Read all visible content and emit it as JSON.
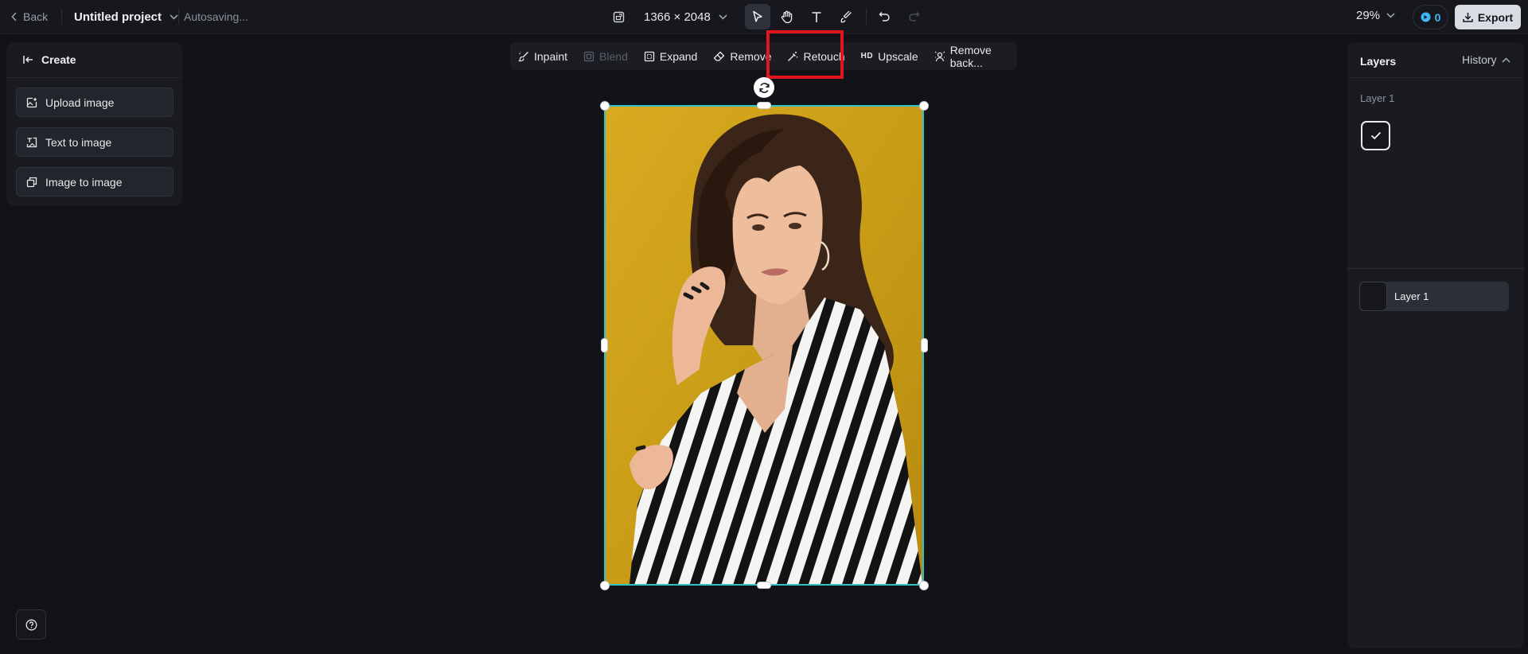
{
  "topbar": {
    "back_label": "Back",
    "project_title": "Untitled project",
    "autosave_status": "Autosaving...",
    "canvas_size": "1366 × 2048",
    "zoom_level": "29%",
    "credits_count": "0",
    "export_label": "Export"
  },
  "tools": [
    "select-icon",
    "hand-icon",
    "text-icon",
    "brush-icon",
    "undo-icon",
    "redo-icon"
  ],
  "create_panel": {
    "title": "Create",
    "buttons": [
      {
        "label": "Upload image",
        "icon": "upload-image-icon"
      },
      {
        "label": "Text to image",
        "icon": "text-to-image-icon"
      },
      {
        "label": "Image to image",
        "icon": "image-to-image-icon"
      }
    ]
  },
  "edit_toolbar": {
    "items": [
      {
        "label": "Inpaint",
        "icon": "inpaint-icon",
        "enabled": true
      },
      {
        "label": "Blend",
        "icon": "blend-icon",
        "enabled": false
      },
      {
        "label": "Expand",
        "icon": "expand-icon",
        "enabled": true
      },
      {
        "label": "Remove",
        "icon": "eraser-icon",
        "enabled": true
      },
      {
        "label": "Retouch",
        "icon": "magic-wand-icon",
        "enabled": true,
        "highlighted": true
      },
      {
        "label": "Upscale",
        "badge": "HD",
        "enabled": true
      },
      {
        "label": "Remove back...",
        "icon": "remove-background-icon",
        "enabled": true
      }
    ]
  },
  "layers_panel": {
    "tab_layers": "Layers",
    "tab_history": "History",
    "section_label": "Layer 1",
    "layer_name": "Layer 1"
  },
  "colors": {
    "background": "#111318",
    "panel": "#191b21",
    "selection": "#31c2c6",
    "highlight": "#e0161c",
    "credits": "#3fb6f5",
    "photo_backdrop": "#c9a017"
  }
}
